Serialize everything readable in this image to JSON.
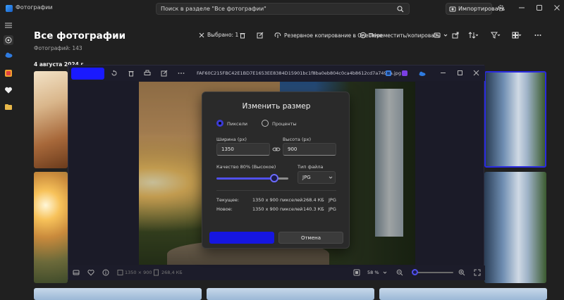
{
  "app": {
    "title": "Фотографии"
  },
  "search": {
    "placeholder": "Поиск в разделе \"Все фотографии\""
  },
  "titlebar": {
    "import_label": "Импортировать"
  },
  "header": {
    "title": "Все фотографии",
    "count": "Фотографий: 143",
    "selected": "Выбрано: 1",
    "backup": "Резервное копирование в OneDrive",
    "move_copy": "Переместить/копировать",
    "date_group": "4 августа 2024 г."
  },
  "viewer": {
    "filename": "FAF60C215FBC42E1BD7E1653EE8384D15901bc1f8ba0eb804c0ca4b8612cd7a7495a.jpg",
    "status_dimensions": "1350 × 900",
    "status_size": "268,4 КБ",
    "zoom": "58 %",
    "zoom_level": 0.05
  },
  "dialog": {
    "title": "Изменить размер",
    "mode_pixels": "Пиксели",
    "mode_percent": "Проценты",
    "width_label": "Ширина (px)",
    "width_value": "1350",
    "height_label": "Высота (px)",
    "height_value": "900",
    "quality_label": "Качество 80% (Высокое)",
    "quality_value": 0.8,
    "filetype_label": "Тип файла",
    "filetype_value": "JPG",
    "current_label": "Текущее:",
    "current_dims": "1350 x 900 пикселей",
    "current_size": "268.4 КБ",
    "current_type": "JPG",
    "new_label": "Новое:",
    "new_dims": "1350 x 900 пикселей",
    "new_size": "140.3 КБ",
    "new_type": "JPG",
    "cancel_label": "Отмена"
  },
  "colors": {
    "accent": "#1616e0",
    "accent_slider": "#5050ee"
  }
}
